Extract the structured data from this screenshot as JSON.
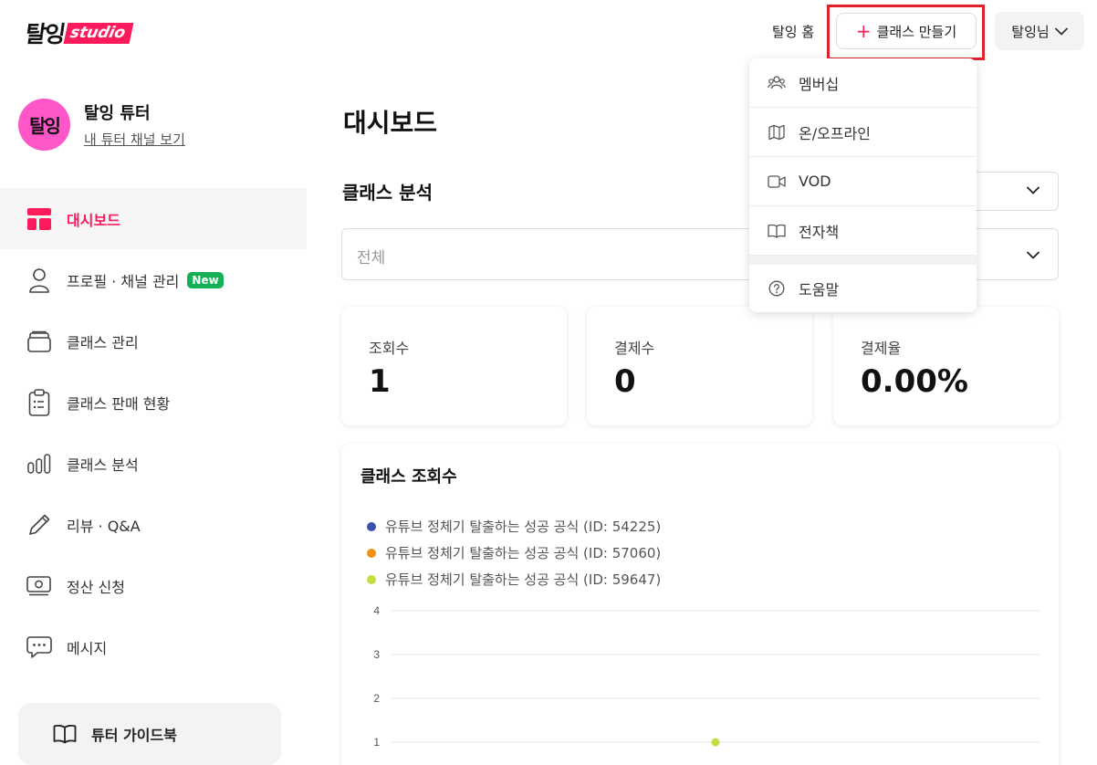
{
  "header": {
    "logo_main": "탈잉",
    "logo_sub": "studio",
    "home_link": "탈잉 홈",
    "create_plus": "+",
    "create_label": "클래스 만들기",
    "user_label": "탈잉님"
  },
  "profile": {
    "avatar_text": "탈잉",
    "name": "탈잉 튜터",
    "channel_link": "내 튜터 채널 보기"
  },
  "nav": {
    "items": [
      {
        "label": "대시보드",
        "icon": "dashboard-icon",
        "active": true
      },
      {
        "label": "프로필 · 채널 관리",
        "icon": "person-icon",
        "badge": "New"
      },
      {
        "label": "클래스 관리",
        "icon": "class-box-icon"
      },
      {
        "label": "클래스 판매 현황",
        "icon": "clipboard-icon"
      },
      {
        "label": "클래스 분석",
        "icon": "bar-chart-icon"
      },
      {
        "label": "리뷰 · Q&A",
        "icon": "pencil-icon"
      },
      {
        "label": "정산 신청",
        "icon": "money-icon"
      },
      {
        "label": "메시지",
        "icon": "chat-icon"
      }
    ],
    "guide_label": "튜터 가이드북"
  },
  "main": {
    "title": "대시보드",
    "section_title": "클래스 분석",
    "filter_value": "전체",
    "stats": [
      {
        "label": "조회수",
        "value": "1"
      },
      {
        "label": "결제수",
        "value": "0"
      },
      {
        "label": "결제율",
        "value": "0.00%"
      }
    ]
  },
  "chart_data": {
    "type": "line",
    "title": "클래스 조회수",
    "yticks": [
      "4",
      "3",
      "2",
      "1"
    ],
    "ylim": [
      1,
      4
    ],
    "grid": true,
    "series": [
      {
        "name": "유튜브 정체기 탈출하는 성공 공식 (ID: 54225)",
        "color": "#3a4fb0",
        "values": []
      },
      {
        "name": "유튜브 정체기 탈출하는 성공 공식 (ID: 57060)",
        "color": "#f29111",
        "values": []
      },
      {
        "name": "유튜브 정체기 탈출하는 성공 공식 (ID: 59647)",
        "color": "#c3de3f",
        "values": [
          1
        ]
      }
    ]
  },
  "menu": {
    "items": [
      {
        "label": "멤버십",
        "icon": "members-icon"
      },
      {
        "label": "온/오프라인",
        "icon": "map-icon"
      },
      {
        "label": "VOD",
        "icon": "video-icon"
      },
      {
        "label": "전자책",
        "icon": "book-icon"
      }
    ],
    "help_label": "도움말"
  }
}
